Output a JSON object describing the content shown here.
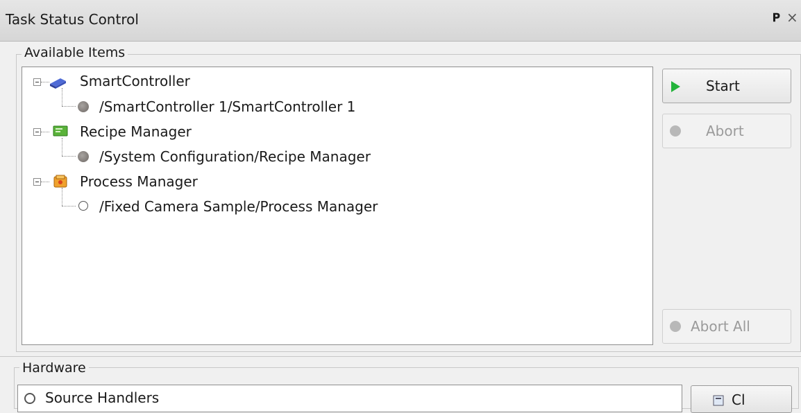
{
  "window": {
    "title": "Task Status Control",
    "pin_glyph": "P",
    "close_glyph": "×"
  },
  "available": {
    "label": "Available Items",
    "tree": [
      {
        "label": "SmartController",
        "icon": "smartcontroller-icon",
        "child": {
          "label": "/SmartController 1/SmartController 1",
          "status": "stopped"
        }
      },
      {
        "label": "Recipe Manager",
        "icon": "recipe-manager-icon",
        "child": {
          "label": "/System Configuration/Recipe Manager",
          "status": "stopped"
        }
      },
      {
        "label": "Process Manager",
        "icon": "process-manager-icon",
        "child": {
          "label": "/Fixed Camera Sample/Process Manager",
          "status": "idle"
        }
      }
    ]
  },
  "buttons": {
    "start": "Start",
    "abort": "Abort",
    "abort_all": "Abort All"
  },
  "hardware": {
    "label": "Hardware",
    "first_item": "Source Handlers",
    "side_button": "Cl"
  },
  "colors": {
    "start_accent": "#23b33b"
  }
}
